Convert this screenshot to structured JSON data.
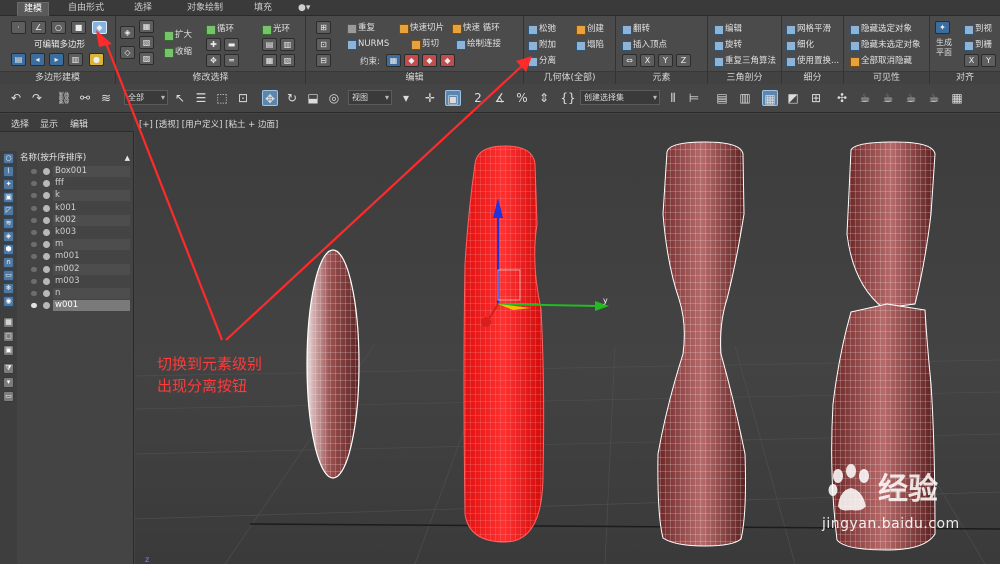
{
  "ribbon_tabs": [
    "建模",
    "自由形式",
    "选择",
    "对象绘制",
    "填充"
  ],
  "ribbon": {
    "poly_modeling": {
      "edit_poly_label": "可编辑多边形",
      "title": "多边形建模"
    },
    "modify_selection": {
      "expand": "扩大",
      "shrink": "收缩",
      "loop": "循环",
      "ring": "光环",
      "title": "修改选择"
    },
    "edit": {
      "repeat": "重复",
      "quickslice": "快速切片",
      "quickloop": "快速 循环",
      "nurms": "NURMS",
      "cut": "剪切",
      "swiftloop": "绘制连接",
      "constraints": "约束:",
      "title": "编辑"
    },
    "geometry": {
      "relax": "松弛",
      "create": "创建",
      "attach": "附加",
      "collapse": "塌陷",
      "detach": "分离",
      "title": "几何体(全部)"
    },
    "elements": {
      "flip": "翻转",
      "insert_vertex": "插入顶点",
      "x": "X",
      "y": "Y",
      "z": "Z",
      "title": "元素"
    },
    "tris": {
      "edit": "编辑",
      "turn": "旋转",
      "retriangulate": "重复三角算法",
      "title": "三角剖分"
    },
    "subdivision": {
      "meshsmooth": "网格平滑",
      "tessellate": "细化",
      "use_displacement": "使用置换...",
      "title": "细分"
    },
    "visibility": {
      "hide_sel": "隐藏选定对象",
      "hide_unsel": "隐藏未选定对象",
      "unhide_all": "全部取消隐藏",
      "title": "可见性"
    },
    "align": {
      "make_planar": "生成平面",
      "to_view": "到视",
      "to_grid": "到栅",
      "x": "X",
      "y": "Y",
      "title": "对齐"
    }
  },
  "toolbar": {
    "filter": "全部",
    "ref_coord": "视图",
    "sel_set": "创建选择集"
  },
  "explorer": {
    "menu": [
      "选择",
      "显示",
      "编辑"
    ],
    "header": "名称(按升序排序)",
    "objects": [
      "Box001",
      "fff",
      "k",
      "k001",
      "k002",
      "k003",
      "m",
      "m001",
      "m002",
      "m003",
      "n",
      "w001"
    ]
  },
  "viewport": {
    "label": "[+] [透视] [用户定义] [粘土 + 边面]",
    "axis_y": "y"
  },
  "annotation": [
    "切换到元素级别",
    "出现分离按钮"
  ],
  "watermark": {
    "brand": "经验",
    "url": "jingyan.baidu.com"
  },
  "colors": {
    "selected_object": "#ff1a1a",
    "annotation": "#ff3a3a",
    "mesh": "#7a2f2f"
  }
}
